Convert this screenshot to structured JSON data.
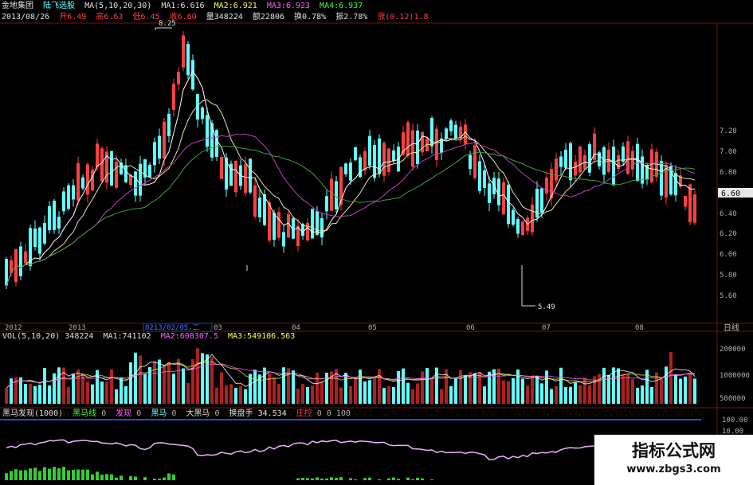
{
  "header": {
    "stock_name": "金地集团",
    "indicator_name": "陆飞选股",
    "ma_params": "MA(5,10,20,30)",
    "ma1": "MA1:6.616",
    "ma2": "MA2:6.921",
    "ma3": "MA3:6.923",
    "ma4": "MA4:6.937",
    "date": "2013/08/26",
    "open": "开6.49",
    "high": "高6.63",
    "low": "低6.45",
    "close": "收6.60",
    "volume": "量348224",
    "amount": "额22806",
    "turnover": "换0.78%",
    "amplitude": "振2.78%",
    "change": "涨(0.12)1.8"
  },
  "price_axis": {
    "labels": [
      "7.20",
      "7.00",
      "6.80",
      "6.60",
      "6.40",
      "6.20",
      "6.00",
      "5.80",
      "5.60"
    ],
    "current_price": "6.60"
  },
  "annotations": {
    "high_mark": "8.25",
    "low_mark": "5.49"
  },
  "time_axis": {
    "labels": [
      "2012",
      "2013",
      "0213/02/05,二",
      "03",
      "04",
      "05",
      "06",
      "07",
      "08"
    ],
    "period": "日线"
  },
  "volume_panel": {
    "header": "VOL(5,10,20)",
    "value": "348224",
    "ma1": "MA1:741102",
    "ma2": "MA2:608307.5",
    "ma3": "MA3:549106.563",
    "axis_labels": [
      "200000",
      "1000000",
      "500000"
    ]
  },
  "indicator_panel": {
    "name": "黑马发现(1000)",
    "items": [
      {
        "label": "黑马线",
        "value": "0"
      },
      {
        "label": "发现",
        "value": "0"
      },
      {
        "label": "黑马",
        "value": "0"
      },
      {
        "label": "大黑马",
        "value": "0"
      },
      {
        "label": "换盘手",
        "value": "34.534"
      },
      {
        "label": "庄控",
        "value": "0"
      }
    ],
    "trailing": "0 100",
    "axis_labels": [
      "100.00",
      "10.00"
    ]
  },
  "watermark": {
    "title": "指标公式网",
    "url": "www.zbgs3.com"
  },
  "colors": {
    "up": "#ff4040",
    "down": "#60ffff",
    "ma_yellow": "#e8e0a0",
    "ma_white": "#ffffff",
    "ma_purple": "#c040c0",
    "ma_green": "#40a040",
    "osc": "#f0b0ff",
    "bar_green": "#30d030"
  }
}
